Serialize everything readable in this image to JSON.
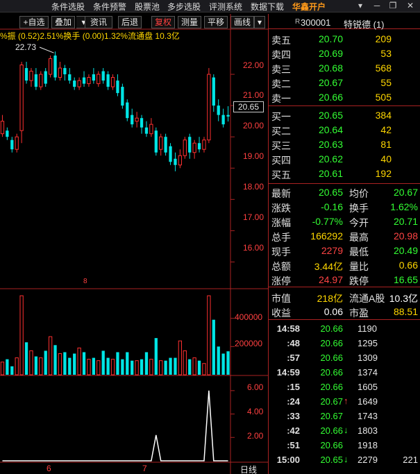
{
  "menu": {
    "items": [
      "条件选股",
      "条件预警",
      "股票池",
      "多步选股",
      "评测系统",
      "数据下载"
    ],
    "brand": "华鑫开户",
    "window_controls": [
      "▾",
      "─",
      "❐",
      "✕"
    ]
  },
  "toolbar": {
    "buttons": [
      "+自选",
      "叠加",
      "资讯",
      "后退",
      "复权",
      "测量",
      "平移",
      "画线"
    ],
    "dropdown_arrow": "▾"
  },
  "info_line": "%振 (0.52)2.51%换手 (0.00)1.32%流通盘 10.3亿",
  "chart": {
    "high_marker": "22.73",
    "current_price": "20.65",
    "price_axis": [
      "22.00",
      "21.00",
      "20.00",
      "19.00",
      "18.00",
      "17.00",
      "16.00"
    ],
    "volume_axis": [
      "400000",
      "200000"
    ],
    "indicator_axis": [
      "6.00",
      "4.00",
      "2.00"
    ],
    "mid_marker": "8",
    "x_labels": [
      "6",
      "7"
    ],
    "period_label": "日线"
  },
  "chart_data": {
    "type": "candlestick",
    "up_color": "#ff3030",
    "down_color": "#00e5e5",
    "price_ylim": [
      15.5,
      23.0
    ],
    "candles": [
      {
        "o": 20.1,
        "c": 20.5,
        "h": 20.7,
        "l": 20.0
      },
      {
        "o": 20.2,
        "c": 20.0,
        "h": 20.3,
        "l": 19.9
      },
      {
        "o": 19.9,
        "c": 19.6,
        "h": 20.0,
        "l": 19.5
      },
      {
        "o": 19.6,
        "c": 20.0,
        "h": 20.1,
        "l": 19.5
      },
      {
        "o": 20.2,
        "c": 22.3,
        "h": 22.4,
        "l": 19.8
      },
      {
        "o": 22.2,
        "c": 21.8,
        "h": 22.4,
        "l": 21.7
      },
      {
        "o": 21.8,
        "c": 22.1,
        "h": 22.2,
        "l": 21.6
      },
      {
        "o": 22.0,
        "c": 21.6,
        "h": 22.2,
        "l": 21.5
      },
      {
        "o": 21.6,
        "c": 22.0,
        "h": 22.1,
        "l": 21.5
      },
      {
        "o": 22.1,
        "c": 21.7,
        "h": 22.2,
        "l": 21.6
      },
      {
        "o": 22.0,
        "c": 22.5,
        "h": 22.6,
        "l": 21.9
      },
      {
        "o": 22.6,
        "c": 21.9,
        "h": 22.73,
        "l": 21.8
      },
      {
        "o": 21.9,
        "c": 22.2,
        "h": 22.4,
        "l": 21.8
      },
      {
        "o": 22.2,
        "c": 22.0,
        "h": 22.3,
        "l": 21.8
      },
      {
        "o": 22.0,
        "c": 21.8,
        "h": 22.2,
        "l": 21.7
      },
      {
        "o": 21.8,
        "c": 21.6,
        "h": 21.9,
        "l": 21.5
      },
      {
        "o": 21.6,
        "c": 21.8,
        "h": 21.9,
        "l": 21.5
      },
      {
        "o": 21.9,
        "c": 21.7,
        "h": 22.1,
        "l": 21.6
      },
      {
        "o": 21.7,
        "c": 21.9,
        "h": 22.0,
        "l": 21.6
      },
      {
        "o": 22.0,
        "c": 21.8,
        "h": 22.2,
        "l": 21.7
      },
      {
        "o": 21.7,
        "c": 22.0,
        "h": 22.1,
        "l": 21.6
      },
      {
        "o": 22.1,
        "c": 21.8,
        "h": 22.2,
        "l": 21.7
      },
      {
        "o": 22.0,
        "c": 21.6,
        "h": 22.1,
        "l": 21.5
      },
      {
        "o": 21.6,
        "c": 21.9,
        "h": 22.0,
        "l": 21.5
      },
      {
        "o": 21.8,
        "c": 21.4,
        "h": 22.0,
        "l": 21.3
      },
      {
        "o": 21.6,
        "c": 21.0,
        "h": 21.7,
        "l": 20.9
      },
      {
        "o": 21.1,
        "c": 20.6,
        "h": 21.2,
        "l": 20.5
      },
      {
        "o": 20.7,
        "c": 20.4,
        "h": 20.9,
        "l": 20.3
      },
      {
        "o": 20.5,
        "c": 20.6,
        "h": 20.8,
        "l": 20.3
      },
      {
        "o": 20.6,
        "c": 20.3,
        "h": 20.7,
        "l": 20.1
      },
      {
        "o": 20.3,
        "c": 20.1,
        "h": 20.5,
        "l": 20.0
      },
      {
        "o": 20.1,
        "c": 20.4,
        "h": 20.6,
        "l": 20.0
      },
      {
        "o": 20.2,
        "c": 19.5,
        "h": 20.3,
        "l": 19.4
      },
      {
        "o": 19.6,
        "c": 20.0,
        "h": 20.1,
        "l": 19.4
      },
      {
        "o": 20.0,
        "c": 19.5,
        "h": 20.1,
        "l": 19.4
      },
      {
        "o": 19.7,
        "c": 19.2,
        "h": 19.8,
        "l": 19.1
      },
      {
        "o": 19.3,
        "c": 19.1,
        "h": 19.5,
        "l": 18.9
      },
      {
        "o": 19.1,
        "c": 19.4,
        "h": 19.6,
        "l": 19.0
      },
      {
        "o": 19.4,
        "c": 19.9,
        "h": 20.0,
        "l": 19.3
      },
      {
        "o": 20.0,
        "c": 19.5,
        "h": 20.1,
        "l": 19.3
      },
      {
        "o": 19.5,
        "c": 19.8,
        "h": 19.9,
        "l": 19.3
      },
      {
        "o": 19.8,
        "c": 19.6,
        "h": 20.0,
        "l": 19.5
      },
      {
        "o": 19.6,
        "c": 19.9,
        "h": 20.0,
        "l": 19.5
      },
      {
        "o": 19.9,
        "c": 22.0,
        "h": 22.2,
        "l": 19.8
      },
      {
        "o": 21.9,
        "c": 21.0,
        "h": 22.0,
        "l": 20.8
      },
      {
        "o": 21.0,
        "c": 20.7,
        "h": 21.2,
        "l": 20.5
      },
      {
        "o": 20.7,
        "c": 20.4,
        "h": 20.9,
        "l": 20.3
      },
      {
        "o": 20.7,
        "c": 20.65,
        "h": 20.98,
        "l": 20.49
      }
    ],
    "volumes": [
      90000,
      110000,
      60000,
      120000,
      560000,
      230000,
      170000,
      130000,
      120000,
      170000,
      270000,
      210000,
      150000,
      160000,
      120000,
      150000,
      190000,
      160000,
      110000,
      120000,
      100000,
      170000,
      120000,
      110000,
      160000,
      110000,
      160000,
      100000,
      100000,
      110000,
      160000,
      110000,
      260000,
      100000,
      100000,
      120000,
      120000,
      240000,
      170000,
      110000,
      120000,
      100000,
      80000,
      560000,
      390000,
      200000,
      150000,
      166292
    ],
    "volume_ylim": [
      0,
      600000
    ],
    "indicator": [
      0,
      0,
      0,
      0,
      0,
      0,
      0,
      0,
      0,
      0,
      0,
      0,
      0,
      0,
      0,
      0,
      0,
      0,
      0,
      0,
      0,
      0,
      0,
      0,
      0,
      0,
      0,
      0,
      0,
      0,
      0,
      0,
      2.2,
      0,
      0,
      0,
      0,
      0,
      0,
      0,
      0,
      0,
      0,
      6.0,
      0,
      0,
      0,
      0
    ],
    "indicator_ylim": [
      0,
      7
    ]
  },
  "quote": {
    "code": "300001",
    "name": "特锐德 (1)",
    "asks": [
      {
        "label": "卖五",
        "price": "20.70",
        "vol": "209"
      },
      {
        "label": "卖四",
        "price": "20.69",
        "vol": "53"
      },
      {
        "label": "卖三",
        "price": "20.68",
        "vol": "568"
      },
      {
        "label": "卖二",
        "price": "20.67",
        "vol": "55"
      },
      {
        "label": "卖一",
        "price": "20.66",
        "vol": "505"
      }
    ],
    "bids": [
      {
        "label": "买一",
        "price": "20.65",
        "vol": "384"
      },
      {
        "label": "买二",
        "price": "20.64",
        "vol": "42"
      },
      {
        "label": "买三",
        "price": "20.63",
        "vol": "81"
      },
      {
        "label": "买四",
        "price": "20.62",
        "vol": "40"
      },
      {
        "label": "买五",
        "price": "20.61",
        "vol": "192"
      }
    ],
    "stats": [
      {
        "l1": "最新",
        "v1": "20.65",
        "c1": "green",
        "l2": "均价",
        "v2": "20.67",
        "c2": "green"
      },
      {
        "l1": "涨跌",
        "v1": "-0.16",
        "c1": "green",
        "l2": "换手",
        "v2": "1.62%",
        "c2": "green"
      },
      {
        "l1": "涨幅",
        "v1": "-0.77%",
        "c1": "green",
        "l2": "今开",
        "v2": "20.71",
        "c2": "green"
      },
      {
        "l1": "总手",
        "v1": "166292",
        "c1": "yellow",
        "l2": "最高",
        "v2": "20.98",
        "c2": "red"
      },
      {
        "l1": "现手",
        "v1": "2279",
        "c1": "red",
        "l2": "最低",
        "v2": "20.49",
        "c2": "green"
      },
      {
        "l1": "总额",
        "v1": "3.44亿",
        "c1": "yellow",
        "l2": "量比",
        "v2": "0.66",
        "c2": "yellow"
      },
      {
        "l1": "涨停",
        "v1": "24.97",
        "c1": "red",
        "l2": "跌停",
        "v2": "16.65",
        "c2": "green"
      }
    ],
    "fund": [
      {
        "l1": "市值",
        "v1": "218亿",
        "c1": "yellow",
        "l2": "流通A股",
        "v2": "10.3亿",
        "c2": "white"
      },
      {
        "l1": "收益",
        "v1": "0.06",
        "c1": "white",
        "l2": "市盈",
        "v2": "88.51",
        "c2": "yellow"
      }
    ],
    "ticks": [
      {
        "t": "14:58",
        "p": "20.66",
        "a": "",
        "v": "1190",
        "x": ""
      },
      {
        "t": ":48",
        "p": "20.66",
        "a": "",
        "v": "1295",
        "x": ""
      },
      {
        "t": ":57",
        "p": "20.66",
        "a": "",
        "v": "1309",
        "x": ""
      },
      {
        "t": "14:59",
        "p": "20.66",
        "a": "",
        "v": "1374",
        "x": ""
      },
      {
        "t": ":15",
        "p": "20.66",
        "a": "",
        "v": "1605",
        "x": ""
      },
      {
        "t": ":24",
        "p": "20.67",
        "a": "↑",
        "v": "1649",
        "x": ""
      },
      {
        "t": ":33",
        "p": "20.67",
        "a": "",
        "v": "1743",
        "x": ""
      },
      {
        "t": ":42",
        "p": "20.66",
        "a": "↓",
        "v": "1803",
        "x": ""
      },
      {
        "t": ":51",
        "p": "20.66",
        "a": "",
        "v": "1918",
        "x": ""
      },
      {
        "t": "15:00",
        "p": "20.65",
        "a": "↓",
        "v": "2279",
        "x": "221"
      }
    ]
  }
}
